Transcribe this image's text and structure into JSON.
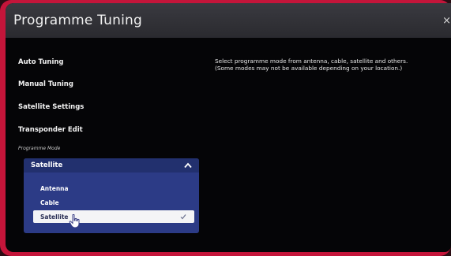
{
  "title": "Programme Tuning",
  "close_glyph": "×",
  "menu": {
    "items": [
      {
        "label": "Auto Tuning"
      },
      {
        "label": "Manual Tuning"
      },
      {
        "label": "Satellite Settings"
      },
      {
        "label": "Transponder Edit"
      }
    ]
  },
  "programme_mode": {
    "label": "Programme Mode",
    "selected_value": "Satellite",
    "options": [
      {
        "label": "Antenna",
        "selected": false
      },
      {
        "label": "Cable",
        "selected": false
      },
      {
        "label": "Satellite",
        "selected": true
      }
    ]
  },
  "description": {
    "line1": "Select programme mode from antenna, cable, satellite and others.",
    "line2": "(Some modes may not be available depending on your location.)"
  },
  "colors": {
    "frame": "#c4153a",
    "dropdown_bg": "#2c3b86",
    "selected_option_bg": "#f4f4f6"
  },
  "icons": {
    "close": "close-icon",
    "dropdown": "chevron-up-icon",
    "selected": "check-icon",
    "pointer": "hand-cursor-icon"
  }
}
